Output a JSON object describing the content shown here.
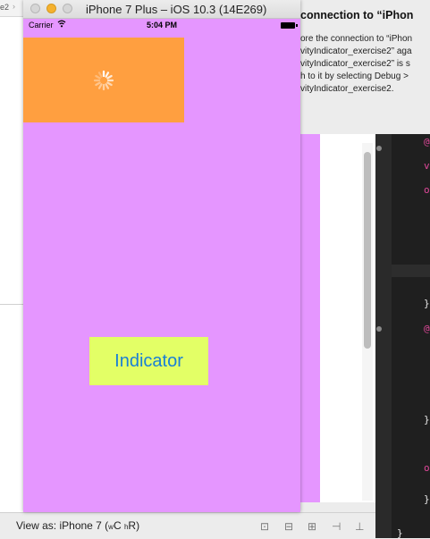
{
  "xcode": {
    "left_tab_fragment": "e2",
    "alert_title": "connection to “iPhon",
    "alert_lines": [
      "ore the connection to “iPhon",
      "vityIndicator_exercise2” aga",
      "vityIndicator_exercise2” is s",
      "h to it by selecting Debug >",
      "vityIndicator_exercise2."
    ],
    "view_as_prefix": "View as: iPhone 7 (",
    "view_as_wc": "wC",
    "view_as_hr": "hR",
    "view_as_suffix": ")",
    "toolbar_icons": [
      "zoom-fit-icon",
      "align-icon",
      "pin-icon",
      "resolve-icon",
      "embed-icon"
    ],
    "code_glyphs": [
      {
        "t": "@",
        "c": "#e0489a"
      },
      {
        "t": "v",
        "c": "#e0489a"
      },
      {
        "t": "o",
        "c": "#e0489a"
      },
      {
        "t": "}",
        "c": "#e8e8e8"
      },
      {
        "t": "@",
        "c": "#e0489a"
      },
      {
        "t": "}",
        "c": "#e8e8e8"
      },
      {
        "t": "o",
        "c": "#e0489a"
      },
      {
        "t": "}",
        "c": "#e8e8e8"
      },
      {
        "t": "}",
        "c": "#e8e8e8"
      }
    ]
  },
  "simulator": {
    "title": "iPhone 7 Plus – iOS 10.3 (14E269)",
    "status": {
      "carrier": "Carrier",
      "time": "5:04 PM"
    },
    "button_label": "Indicator",
    "colors": {
      "background": "#e596ff",
      "orange_view": "#ff9f40",
      "button_bg": "#e3ff66",
      "button_text": "#1a7fd6"
    }
  }
}
